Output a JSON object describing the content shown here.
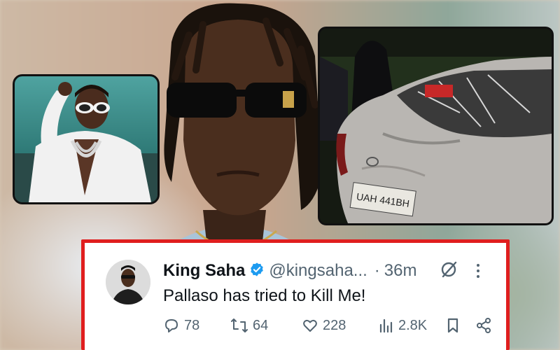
{
  "tweet": {
    "display_name": "King Saha",
    "handle": "@kingsaha...",
    "separator": "·",
    "time": "36m",
    "text": "Pallaso has tried to Kill Me!",
    "replies": "78",
    "reposts": "64",
    "likes": "228",
    "views": "2.8K"
  },
  "car_plate": "UAH 441BH",
  "colors": {
    "card_border": "#e01e1e",
    "verified": "#1d9bf0",
    "text_primary": "#0f1419",
    "text_secondary": "#536471"
  },
  "icons": [
    "verified-badge-icon",
    "grok-icon",
    "more-icon",
    "reply-icon",
    "repost-icon",
    "like-icon",
    "views-icon",
    "bookmark-icon",
    "share-icon"
  ]
}
